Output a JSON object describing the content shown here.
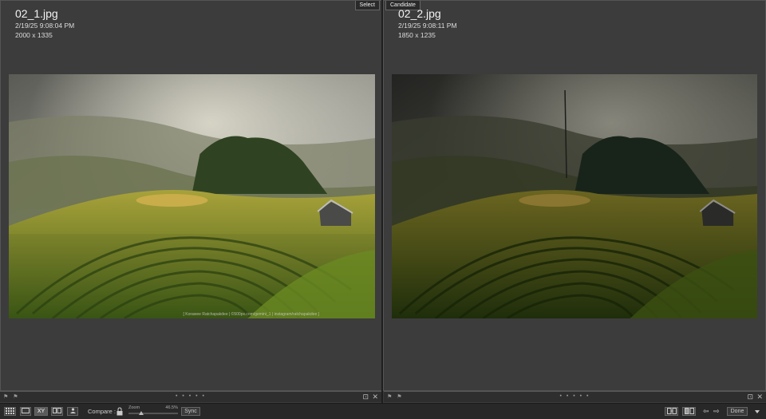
{
  "left_pane": {
    "tag": "Select",
    "filename": "02_1.jpg",
    "datetime": "2/19/25 9:08:04 PM",
    "dimensions": "2000 x 1335",
    "credit": "[ Korawee Ratchapakdee | ©500px.com/gemini_1 | instagram/ratchapakdee ]"
  },
  "right_pane": {
    "tag": "Candidate",
    "filename": "02_2.jpg",
    "datetime": "2/19/25 9:08:11 PM",
    "dimensions": "1850 x 1235"
  },
  "panebar": {
    "flags": "⚑ ⚑",
    "dots": "• • • • •",
    "close": "✕",
    "expand": "⊡"
  },
  "toolbar": {
    "grid_icon": "grid-icon",
    "loupe_icon": "loupe-icon",
    "compare_view": "XY",
    "survey_icon": "survey-icon",
    "people_icon": "people-icon",
    "compare_label": "Compare :",
    "zoom_label": "Zoom",
    "zoom_value": "46.5%",
    "zoom_fraction": 0.25,
    "sync_label": "Sync",
    "swap_icon": "swap-icon",
    "make_select_icon": "make-select-icon",
    "prev_arrow": "⇦",
    "next_arrow": "⇨",
    "done_label": "Done",
    "menu_icon": "chevron-down-icon"
  }
}
